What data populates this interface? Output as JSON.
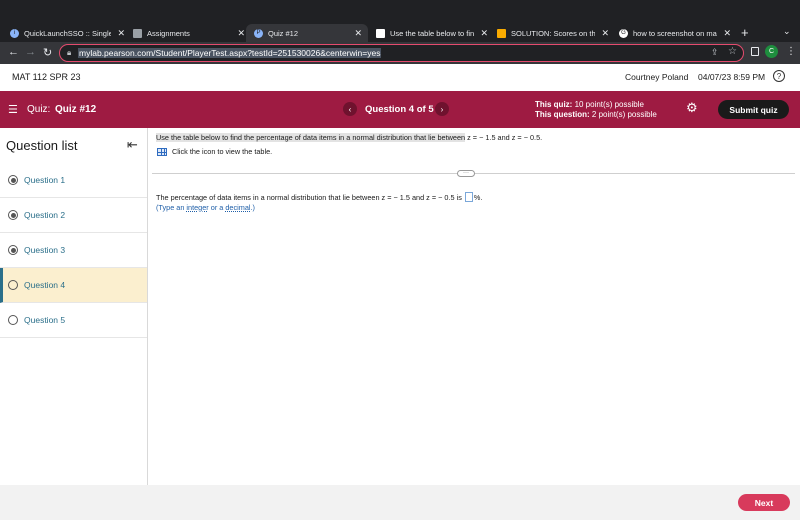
{
  "browser": {
    "tabs": [
      {
        "title": "QuickLaunchSSO :: Single S",
        "icon": "info-icon",
        "icon_color": "#8ab4f8"
      },
      {
        "title": "Assignments",
        "icon": "document-icon",
        "icon_color": "#9aa0a6"
      },
      {
        "title": "Quiz #12",
        "icon": "pearson-icon",
        "icon_color": "#8ab4f8"
      },
      {
        "title": "Use the table below to find t",
        "icon": "black-square-icon",
        "icon_color": "#ffffff"
      },
      {
        "title": "SOLUTION: Scores on the G",
        "icon": "bookmark-icon",
        "icon_color": "#f9ab00"
      },
      {
        "title": "how to screenshot on mac",
        "icon": "google-icon",
        "icon_color": "#ffffff"
      }
    ],
    "url": "mylab.pearson.com/Student/PlayerTest.aspx?testId=251530026&centerwin=yes",
    "profile_initial": "C"
  },
  "header": {
    "course": "MAT 112 SPR 23",
    "user": "Courtney Poland",
    "datetime": "04/07/23 8:59 PM"
  },
  "quizbar": {
    "quiz_label": "Quiz:",
    "quiz_name": "Quiz #12",
    "question_counter": "Question 4 of 5",
    "this_quiz_label": "This quiz:",
    "this_quiz_value": "10 point(s) possible",
    "this_question_label": "This question:",
    "this_question_value": "2 point(s) possible",
    "submit_label": "Submit quiz"
  },
  "sidebar": {
    "title": "Question list",
    "items": [
      {
        "label": "Question 1",
        "answered": true,
        "current": false
      },
      {
        "label": "Question 2",
        "answered": true,
        "current": false
      },
      {
        "label": "Question 3",
        "answered": true,
        "current": false
      },
      {
        "label": "Question 4",
        "answered": false,
        "current": true
      },
      {
        "label": "Question 5",
        "answered": false,
        "current": false
      }
    ]
  },
  "question": {
    "prompt_highlighted": "Use the table below to find the percentage of data items in a normal distribution that lie between",
    "prompt_rest": " z = − 1.5 and z = − 0.5.",
    "table_link": "Click the icon to view the table.",
    "answer_before": "The percentage of data items in a normal distribution that lie between z = − 1.5 and z = − 0.5 is",
    "answer_after": "%.",
    "hint_open": "(Type an ",
    "hint_integer": "integer",
    "hint_or": " or a ",
    "hint_decimal": "decimal",
    "hint_close": ".)"
  },
  "footer": {
    "next_label": "Next"
  },
  "colors": {
    "quiz_bar": "#9e1b42",
    "next_button": "#d83a5c",
    "link": "#2b6f8a"
  }
}
